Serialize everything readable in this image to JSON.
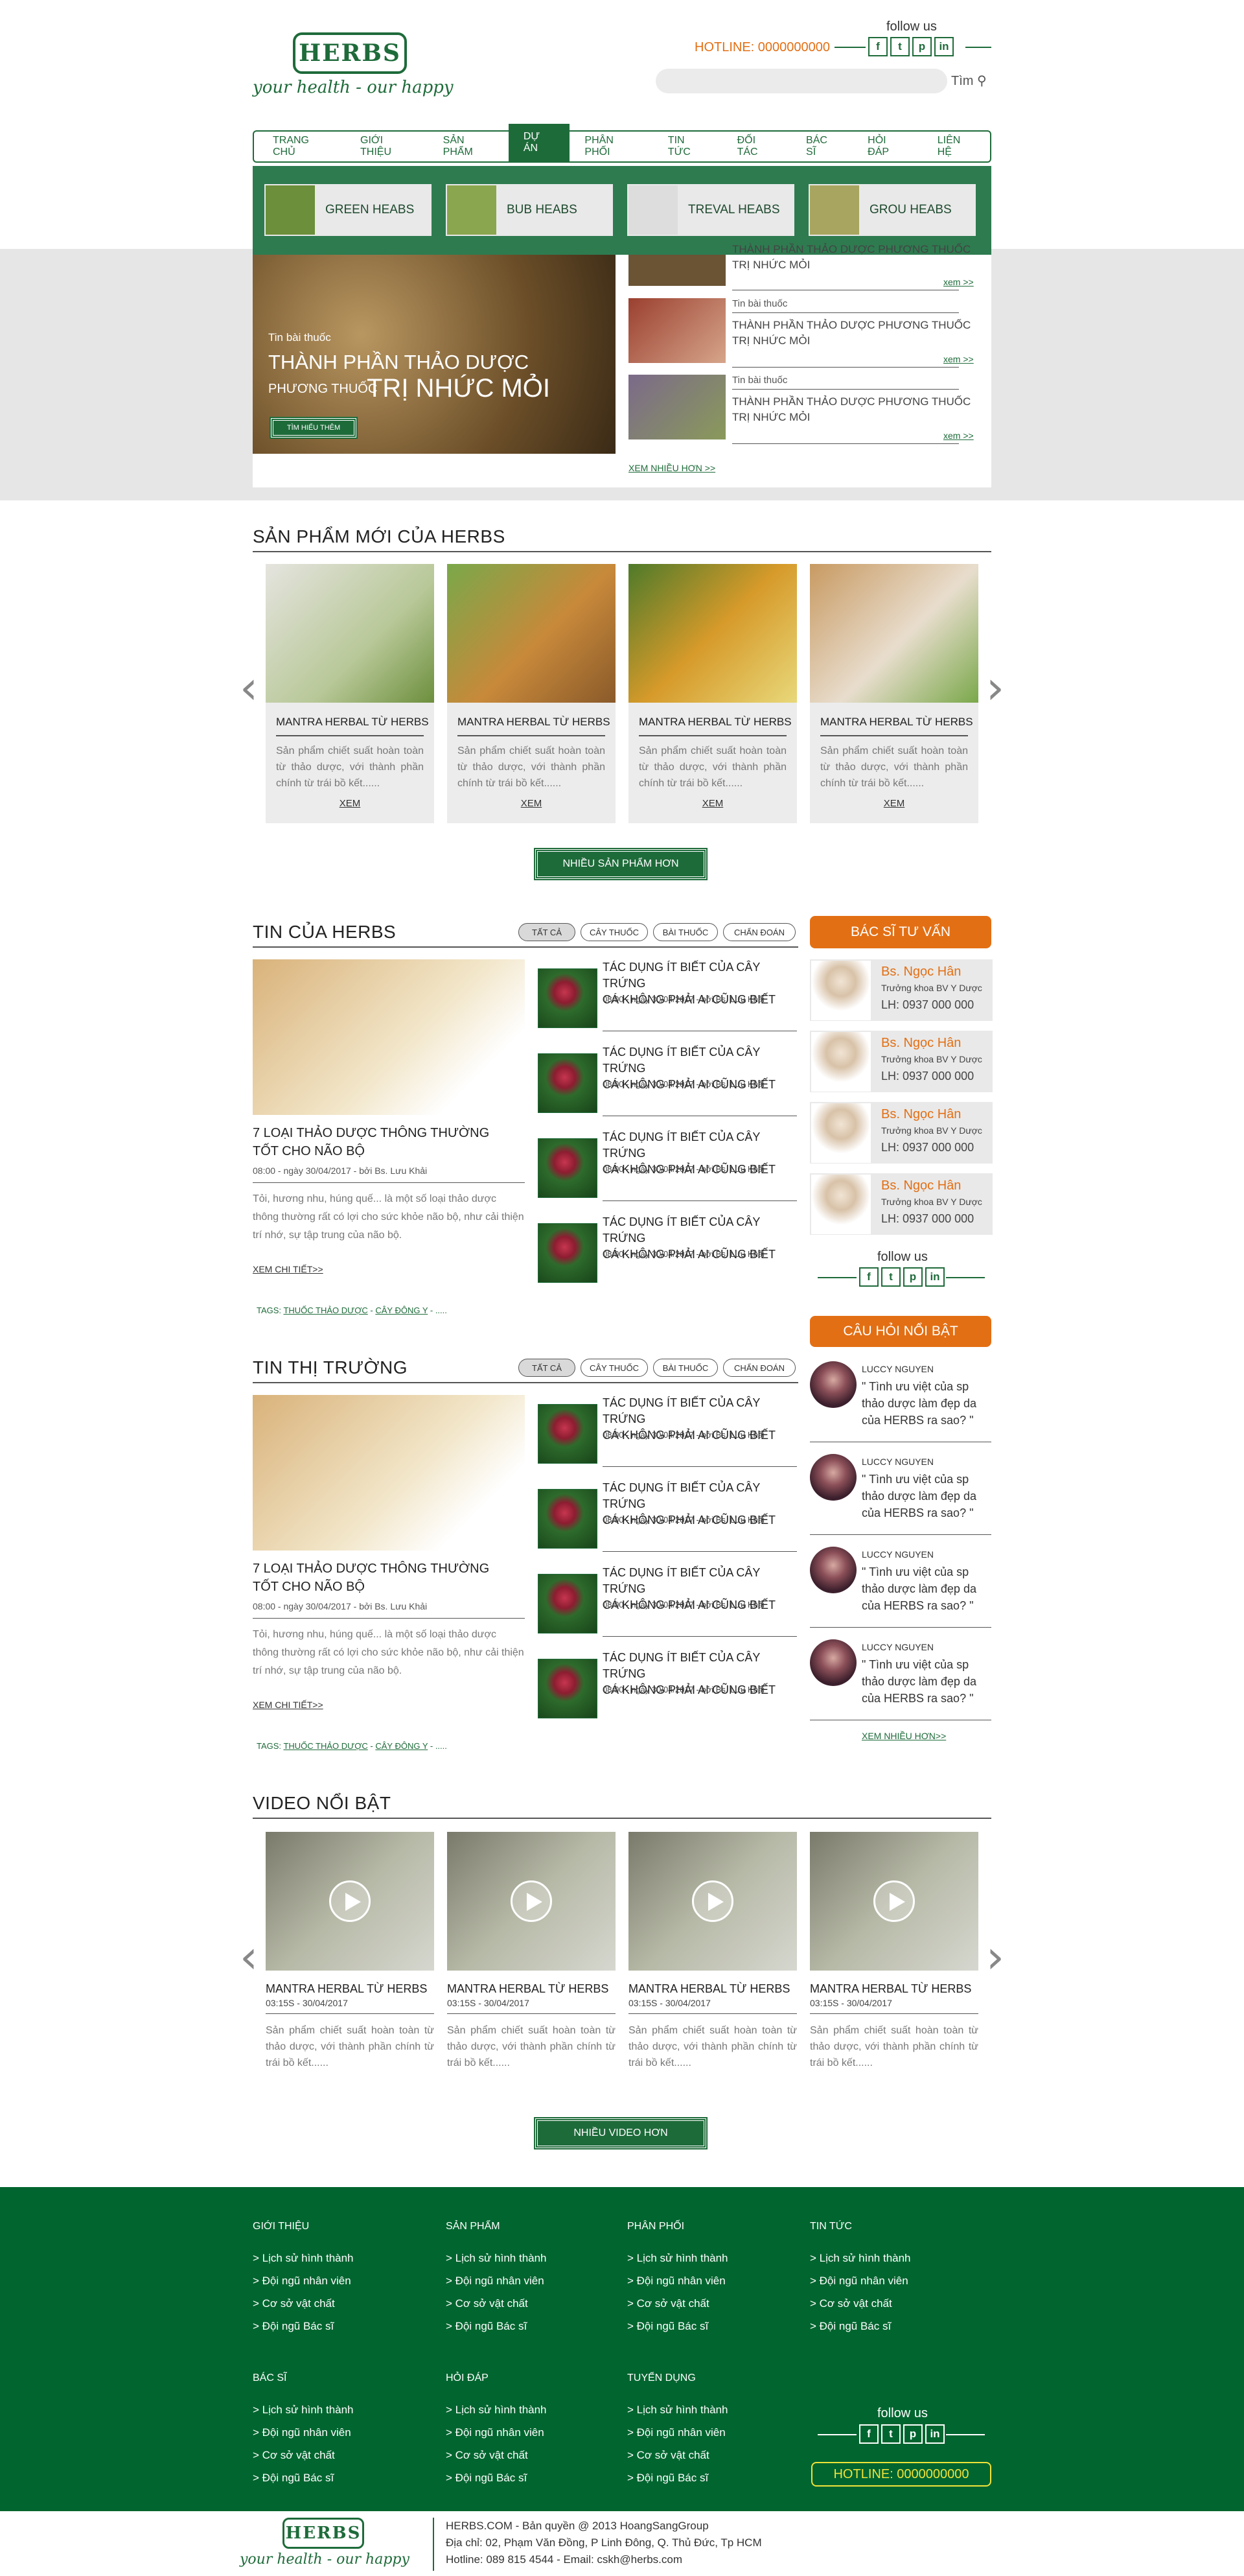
{
  "header": {
    "logo": "HERBS",
    "slogan": "your health - our happy",
    "follow_us": "follow us",
    "hotline": "HOTLINE: 0000000000",
    "search_placeholder": "",
    "search_label": "Tìm",
    "social": [
      "f",
      "t",
      "p",
      "in"
    ]
  },
  "nav": [
    "TRANG CHỦ",
    "GIỚI THIỆU",
    "SẢN PHẨM",
    "DỰ ÁN",
    "PHÂN PHỐI",
    "TIN TỨC",
    "ĐỐI TÁC",
    "BÁC SĨ",
    "HỎI ĐÁP",
    "LIÊN HỆ"
  ],
  "mega_menu": [
    "GREEN HEABS",
    "BUB HEABS",
    "TREVAL  HEABS",
    "GROU HEABS"
  ],
  "hero": {
    "category": "Tin bài thuốc",
    "title_line1": "THÀNH PHẦN THẢO DƯỢC",
    "title_line2a": "PHƯƠNG THUỐC",
    "title_line2b": "TRỊ NHỨC MỎI",
    "button": "TÌM HIỂU THÊM"
  },
  "side_news": [
    {
      "category": "",
      "title1": "THÀNH PHẦN THẢO DƯỢC PHƯƠNG THUỐC",
      "title2": "TRỊ NHỨC MỎI",
      "more": "xem >>"
    },
    {
      "category": "Tin bài thuốc",
      "title1": "THÀNH PHẦN THẢO DƯỢC PHƯƠNG THUỐC",
      "title2": "TRỊ NHỨC MỎI",
      "more": "xem >>"
    },
    {
      "category": "Tin bài thuốc",
      "title1": "THÀNH PHẦN THẢO DƯỢC PHƯƠNG THUỐC",
      "title2": "TRỊ NHỨC MỎI",
      "more": "xem >>"
    }
  ],
  "side_news_more": "XEM NHIỀU HƠN >>",
  "products": {
    "title": "SẢN PHẨM MỚI CỦA HERBS",
    "items": [
      {
        "name": "MANTRA HERBAL TỪ HERBS",
        "desc": "Sản phẩm chiết suất hoàn toàn từ thảo dược, với thành phần chính từ trái bồ kết......",
        "more": "XEM"
      },
      {
        "name": "MANTRA HERBAL TỪ HERBS",
        "desc": "Sản phẩm chiết suất hoàn toàn từ thảo dược, với thành phần chính từ trái bồ kết......",
        "more": "XEM"
      },
      {
        "name": "MANTRA HERBAL TỪ HERBS",
        "desc": "Sản phẩm chiết suất hoàn toàn từ thảo dược, với thành phần chính từ trái bồ kết......",
        "more": "XEM"
      },
      {
        "name": "MANTRA HERBAL TỪ HERBS",
        "desc": "Sản phẩm chiết suất hoàn toàn từ thảo dược, với thành phần chính từ trái bồ kết......",
        "more": "XEM"
      }
    ],
    "button": "NHIỀU SẢN PHẨM HƠN"
  },
  "filters": [
    "TẤT CẢ",
    "CÂY THUỐC",
    "BÀI THUỐC",
    "CHẨN ĐOÁN"
  ],
  "news_herbs": {
    "title": "TIN CỦA HERBS",
    "main": {
      "title1": "7 LOẠI THẢO DƯỢC THÔNG THƯỜNG",
      "title2": "TỐT CHO NÃO BỘ",
      "meta": "08:00 - ngày 30/04/2017 - bởi Bs. Lưu Khải",
      "desc": "Tỏi, hương nhu, húng quế... là một số loại thảo dược thông thường rất có lợi cho sức khỏe não bộ, như cải thiện trí nhớ, sự tập trung của não bộ.",
      "more": "XEM CHI TIẾT>>",
      "tags_label": "TAGS:",
      "tag1": "THUỐC THẢO DƯỢC",
      "tag2": "CÂY ĐÔNG Y",
      "tags_tail": " - ....."
    },
    "items": [
      {
        "title1": "TÁC DỤNG ÍT BIẾT CỦA CÂY TRỨNG",
        "title2": "CÁ KHÔNG PHẢI AI CŨNG BIẾT",
        "meta": "08:00 - ngày 30/04/2017 - bởi Bs. Lưu Khải"
      },
      {
        "title1": "TÁC DỤNG ÍT BIẾT CỦA CÂY TRỨNG",
        "title2": "CÁ KHÔNG PHẢI AI CŨNG BIẾT",
        "meta": "08:00 - ngày 30/04/2017 - bởi Bs. Lưu Khải"
      },
      {
        "title1": "TÁC DỤNG ÍT BIẾT CỦA CÂY TRỨNG",
        "title2": "CÁ KHÔNG PHẢI AI CŨNG BIẾT",
        "meta": "08:00 - ngày 30/04/2017 - bởi Bs. Lưu Khải"
      },
      {
        "title1": "TÁC DỤNG ÍT BIẾT CỦA CÂY TRỨNG",
        "title2": "CÁ KHÔNG PHẢI AI CŨNG BIẾT",
        "meta": "08:00 - ngày 30/04/2017 - bởi Bs. Lưu Khải"
      }
    ]
  },
  "news_market": {
    "title": "TIN THỊ TRƯỜNG",
    "main": {
      "title1": "7 LOẠI THẢO DƯỢC THÔNG THƯỜNG",
      "title2": "TỐT CHO NÃO BỘ",
      "meta": "08:00 - ngày 30/04/2017 - bởi Bs. Lưu Khải",
      "desc": "Tỏi, hương nhu, húng quế... là một số loại thảo dược thông thường rất có lợi cho sức khỏe não bộ, như cải thiện trí nhớ, sự tập trung của não bộ.",
      "more": "XEM CHI TIẾT>>",
      "tags_label": "TAGS:",
      "tag1": "THUỐC THẢO DƯỢC",
      "tag2": "CÂY ĐÔNG Y",
      "tags_tail": " - ....."
    },
    "items": [
      {
        "title1": "TÁC DỤNG ÍT BIẾT CỦA CÂY TRỨNG",
        "title2": "CÁ KHÔNG PHẢI AI CŨNG BIẾT",
        "meta": "08:00 - ngày 30/04/2017 - bởi Bs. Lưu Khải"
      },
      {
        "title1": "TÁC DỤNG ÍT BIẾT CỦA CÂY TRỨNG",
        "title2": "CÁ KHÔNG PHẢI AI CŨNG BIẾT",
        "meta": "08:00 - ngày 30/04/2017 - bởi Bs. Lưu Khải"
      },
      {
        "title1": "TÁC DỤNG ÍT BIẾT CỦA CÂY TRỨNG",
        "title2": "CÁ KHÔNG PHẢI AI CŨNG BIẾT",
        "meta": "08:00 - ngày 30/04/2017 - bởi Bs. Lưu Khải"
      },
      {
        "title1": "TÁC DỤNG ÍT BIẾT CỦA CÂY TRỨNG",
        "title2": "CÁ KHÔNG PHẢI AI CŨNG BIẾT",
        "meta": "08:00 - ngày 30/04/2017 - bởi Bs. Lưu Khải"
      }
    ]
  },
  "doctors": {
    "title": "BÁC SĨ TƯ VẤN",
    "items": [
      {
        "name": "Bs. Ngọc Hân",
        "role": "Trưởng khoa BV Y Dược",
        "phone": "LH: 0937 000 000"
      },
      {
        "name": "Bs. Ngọc Hân",
        "role": "Trưởng khoa BV Y Dược",
        "phone": "LH: 0937 000 000"
      },
      {
        "name": "Bs. Ngọc Hân",
        "role": "Trưởng khoa BV Y Dược",
        "phone": "LH: 0937 000 000"
      },
      {
        "name": "Bs. Ngọc Hân",
        "role": "Trưởng khoa BV Y Dược",
        "phone": "LH: 0937 000 000"
      }
    ],
    "follow_us": "follow us"
  },
  "questions": {
    "title": "CÂU HỎI NỔI BẬT",
    "items": [
      {
        "name": "LUCCY NGUYEN",
        "line1": "\" Tình ưu việt của sp",
        "line2": "thảo dược làm đẹp da",
        "line3": "của HERBS ra sao? \""
      },
      {
        "name": "LUCCY NGUYEN",
        "line1": "\" Tình ưu việt của sp",
        "line2": "thảo dược làm đẹp da",
        "line3": "của HERBS ra sao? \""
      },
      {
        "name": "LUCCY NGUYEN",
        "line1": "\" Tình ưu việt của sp",
        "line2": "thảo dược làm đẹp da",
        "line3": "của HERBS ra sao? \""
      },
      {
        "name": "LUCCY NGUYEN",
        "line1": "\" Tình ưu việt của sp",
        "line2": "thảo dược làm đẹp da",
        "line3": "của HERBS ra sao? \""
      }
    ],
    "more": "XEM NHIỀU HƠN>>"
  },
  "videos": {
    "title": "VIDEO NỔI BẬT",
    "items": [
      {
        "name": "MANTRA HERBAL TỪ HERBS",
        "meta": "03:15S - 30/04/2017",
        "desc": "Sản phẩm chiết suất hoàn toàn từ thảo dược, với thành phần chính từ trái bồ kết......"
      },
      {
        "name": "MANTRA HERBAL TỪ HERBS",
        "meta": "03:15S - 30/04/2017",
        "desc": "Sản phẩm chiết suất hoàn toàn từ thảo dược, với thành phần chính từ trái bồ kết......"
      },
      {
        "name": "MANTRA HERBAL TỪ HERBS",
        "meta": "03:15S - 30/04/2017",
        "desc": "Sản phẩm chiết suất hoàn toàn từ thảo dược, với thành phần chính từ trái bồ kết......"
      },
      {
        "name": "MANTRA HERBAL TỪ HERBS",
        "meta": "03:15S - 30/04/2017",
        "desc": "Sản phẩm chiết suất hoàn toàn từ thảo dược, với thành phần chính từ trái bồ kết......"
      }
    ],
    "button": "NHIỀU VIDEO HƠN"
  },
  "footer": {
    "col_titles_row1": [
      "GIỚI THIỆU",
      "SẢN PHẨM",
      "PHÂN PHỐI",
      "TIN TỨC"
    ],
    "col_titles_row2": [
      "BÁC SĨ",
      "HỎI ĐÁP",
      "TUYỂN DỤNG"
    ],
    "links": [
      "> Lịch sử hình thành",
      "> Đội ngũ nhân viên",
      "> Cơ sở vật chất",
      "> Đội ngũ Bác sĩ"
    ],
    "follow_us": "follow us",
    "hotline": "HOTLINE: 0000000000"
  },
  "bottom": {
    "logo": "HERBS",
    "slogan": "your health - our happy",
    "line1": "HERBS.COM - Bản quyền @ 2013 HoangSangGroup",
    "line2": "Địa chỉ: 02, Phạm Văn Đồng, P Linh Đông, Q. Thủ Đức, Tp HCM",
    "line3": "Hotline: 089 815 4544 - Email: cskh@herbs.com"
  },
  "colors": {
    "brand_green": "#1e6b3a",
    "accent_orange": "#e36f14",
    "footer_green": "#00652f"
  }
}
